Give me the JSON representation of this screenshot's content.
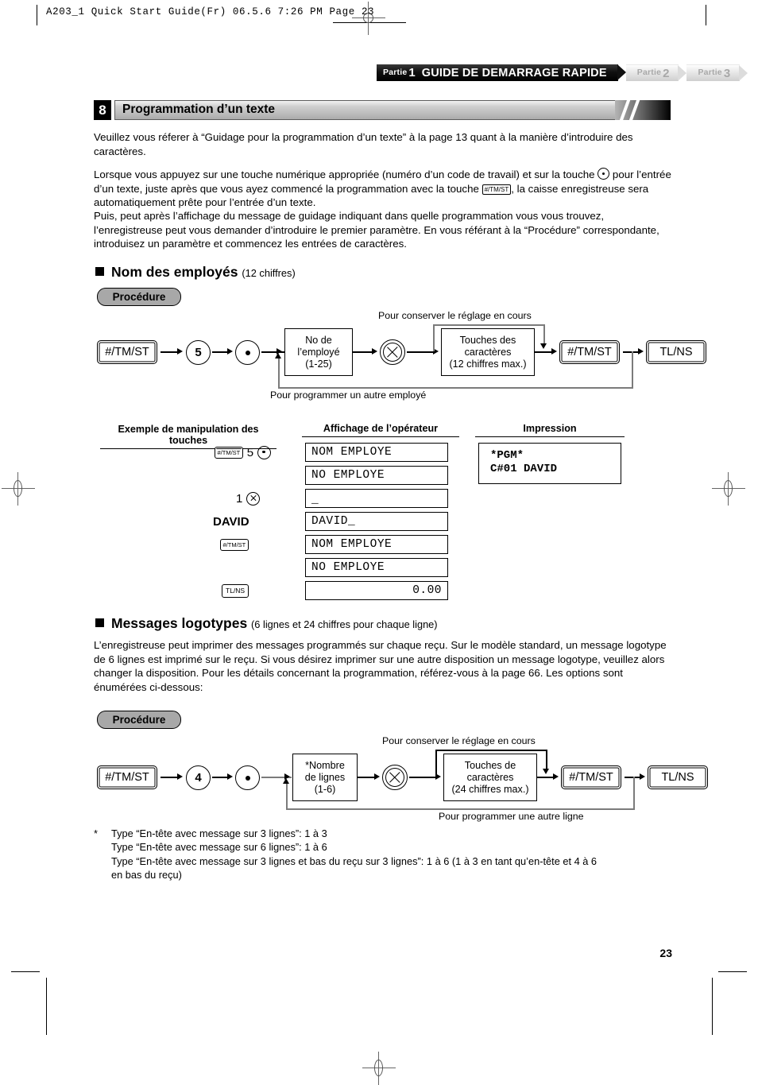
{
  "file_header": "A203_1 Quick Start Guide(Fr)  06.5.6 7:26 PM  Page 23",
  "tabs": [
    {
      "part_label": "Partie",
      "part_num": "1",
      "title": "GUIDE DE DEMARRAGE RAPIDE",
      "active": true
    },
    {
      "part_label": "Partie",
      "part_num": "2",
      "title": "",
      "active": false
    },
    {
      "part_label": "Partie",
      "part_num": "3",
      "title": "",
      "active": false
    }
  ],
  "section": {
    "number": "8",
    "title": "Programmation d’un texte"
  },
  "intro": {
    "p1": "Veuillez vous réferer à “Guidage pour la programmation d’un texte” à la page 13 quant à la manière d’introduire des caractères.",
    "p2_a": "Lorsque vous appuyez sur une touche numérique appropriée (numéro d’un code de travail) et sur la touche",
    "p2_b": "pour l’entrée d’un texte, juste après que vous ayez commencé la programmation avec la touche",
    "p2_key": "#/TM/ST",
    "p2_c": ", la caisse enregistreuse sera automatiquement prête pour l’entrée d’un texte.",
    "p3": "Puis, peut après l’affichage du message de guidage indiquant dans quelle programmation vous vous trouvez, l’enregistreuse peut vous demander d’introduire le premier paramètre.  En vous référant à la “Procédure” correspondante, introduisez un paramètre et commencez les entrées de caractères."
  },
  "employee_section": {
    "heading": "Nom des employés",
    "heading_note": "(12 chiffres)",
    "procedure_label": "Procédure",
    "flow": {
      "key1": "#/TM/ST",
      "digit": "5",
      "dot": "dot-key",
      "box1_line1": "No de",
      "box1_line2": "l’employé",
      "box1_line3": "(1-25)",
      "xkey": "multiply-key",
      "box2_line1": "Touches des",
      "box2_line2": "caractères",
      "box2_line3": "(12 chiffres max.)",
      "key2": "#/TM/ST",
      "key3": "TL/NS",
      "label_top": "Pour conserver le réglage en cours",
      "label_bottom": "Pour programmer un autre employé"
    },
    "table": {
      "col1": "Exemple de manipulation des touches",
      "col2": "Affichage de l’opérateur",
      "col3": "Impression",
      "rows": [
        {
          "keys": "key:#/TM/ST|text:5|circ-dot",
          "display": "NOM EMPLOYE",
          "align": "left"
        },
        {
          "keys": "",
          "display": "NO EMPLOYE",
          "align": "left"
        },
        {
          "keys": "text:1|circ-x",
          "display": "_",
          "align": "left"
        },
        {
          "keys": "name:DAVID",
          "display": "DAVID_",
          "align": "left"
        },
        {
          "keys": "key:#/TM/ST",
          "display": "NOM EMPLOYE",
          "align": "left"
        },
        {
          "keys": "",
          "display": "NO EMPLOYE",
          "align": "left"
        },
        {
          "keys": "key:TL/NS",
          "display": "0.00",
          "align": "right"
        }
      ],
      "print_line1": "*PGM*",
      "print_line2": "C#01    DAVID"
    }
  },
  "logo_section": {
    "heading": "Messages logotypes",
    "heading_note": "(6 lignes et 24 chiffres pour chaque ligne)",
    "body": "L’enregistreuse peut imprimer des messages programmés sur chaque reçu. Sur le modèle standard, un message logotype de 6 lignes est imprimé sur le reçu. Si vous désirez imprimer sur une autre disposition un message logotype, veuillez alors changer la disposition.  Pour les détails concernant la programmation, référez-vous à la page 66. Les options sont énumérées ci-dessous:",
    "procedure_label": "Procédure",
    "flow": {
      "key1": "#/TM/ST",
      "digit": "4",
      "dot": "dot-key",
      "box1_line1": "*Nombre",
      "box1_line2": "de lignes",
      "box1_line3": "(1-6)",
      "xkey": "multiply-key",
      "box2_line1": "Touches de",
      "box2_line2": "caractères",
      "box2_line3": "(24 chiffres max.)",
      "key2": "#/TM/ST",
      "key3": "TL/NS",
      "label_top": "Pour conserver le réglage en cours",
      "label_bottom": "Pour programmer une autre ligne"
    },
    "footnote_marker": "*",
    "footnote_line1": "Type “En-tête avec message sur 3 lignes”: 1 à 3",
    "footnote_line2": "Type “En-tête avec message sur 6 lignes”: 1 à 6",
    "footnote_line3": "Type “En-tête avec message sur 3 lignes et bas du reçu sur 3 lignes”: 1 à 6 (1 à 3 en tant qu’en-tête et 4 à 6",
    "footnote_line4": "en bas du reçu)"
  },
  "page_number": "23"
}
